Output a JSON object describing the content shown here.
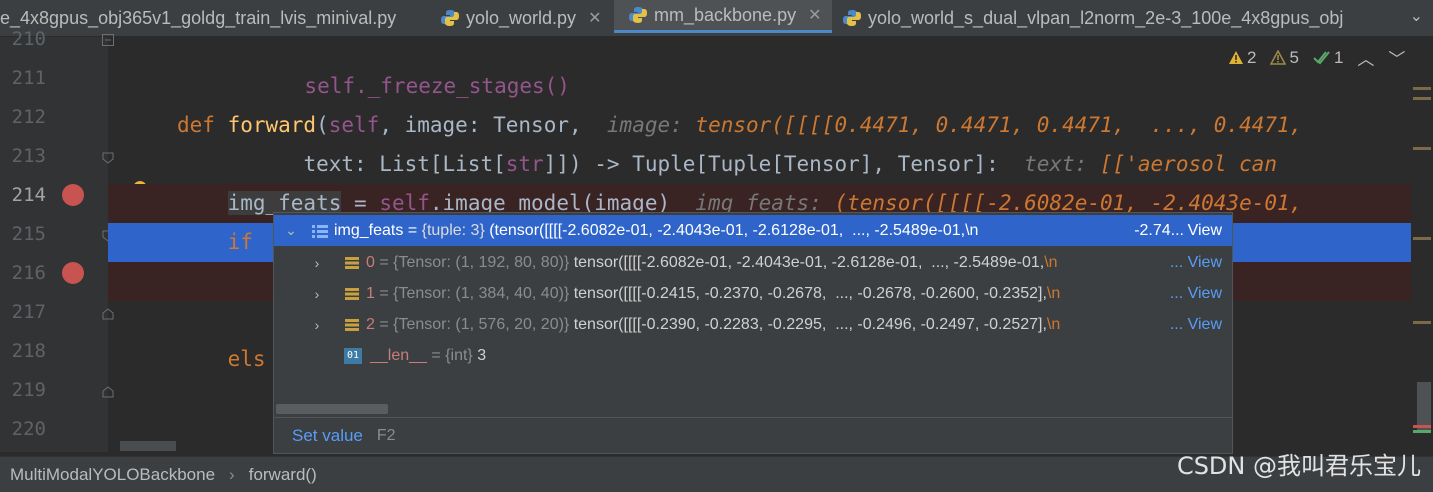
{
  "tabs": [
    {
      "label": "e_4x8gpus_obj365v1_goldg_train_lvis_minival.py",
      "active": false,
      "has_close": false
    },
    {
      "label": "yolo_world.py",
      "active": false,
      "has_close": true
    },
    {
      "label": "mm_backbone.py",
      "active": true,
      "has_close": true
    },
    {
      "label": "yolo_world_s_dual_vlpan_l2norm_2e-3_100e_4x8gpus_obj",
      "active": false,
      "has_close": false
    }
  ],
  "tabs_menu_icon": "chevron-down-icon",
  "inspections": {
    "warnings": "2",
    "weak_warnings": "5",
    "ok": "1"
  },
  "line_numbers": [
    "210",
    "211",
    "212",
    "213",
    "214",
    "215",
    "216",
    "217",
    "218",
    "219",
    "220"
  ],
  "current_line": "214",
  "code": {
    "l210": {
      "text": "    self._freeze_stages()"
    },
    "l212": {
      "kw": "def ",
      "fn": "forward",
      "p1": "(",
      "self": "self",
      "p2": ", image: Tensor,  ",
      "hint_name": "image: ",
      "hint_val": "tensor([[[[0.4471, 0.4471, 0.4471,  ..., 0.4471,"
    },
    "l213": {
      "indent": "          ",
      "p1": "text: List[List[",
      "str": "str",
      "p2": "]]) -> Tuple[Tuple[Tensor], Tensor]:  ",
      "hint_name": "text: ",
      "hint_val": "[['aerosol can"
    },
    "l214": {
      "indent": "    ",
      "var": "img_feats",
      "p1": " = ",
      "self": "self",
      "p2": ".image_model(image)  ",
      "hint_name": "img_feats: ",
      "hint_val": "(tensor([[[[-2.6082e-01, -2.4043e-01,"
    },
    "l215": {
      "indent": "    ",
      "kw": "if"
    },
    "l218": {
      "indent": "    ",
      "kw": "els"
    }
  },
  "debug_popup": {
    "root": {
      "name": "img_feats",
      "eq": " = ",
      "type": "{tuple: 3}",
      "value": " (tensor([[[[-2.6082e-01, -2.4043e-01, -2.6128e-01,  ..., -2.5489e-01,\\n",
      "tail": "-2.74...",
      "link": "View"
    },
    "children": [
      {
        "name": "0",
        "eq": " = ",
        "type": "{Tensor: (1, 192, 80, 80)}",
        "value": " tensor([[[[-2.6082e-01, -2.4043e-01, -2.6128e-01,  ..., -2.5489e-01,",
        "esc": "\\n",
        "link": "... View"
      },
      {
        "name": "1",
        "eq": " = ",
        "type": "{Tensor: (1, 384, 40, 40)}",
        "value": " tensor([[[[-0.2415, -0.2370, -0.2678,  ..., -0.2678, -0.2600, -0.2352],",
        "esc": "\\n",
        "link": "... View"
      },
      {
        "name": "2",
        "eq": " = ",
        "type": "{Tensor: (1, 576, 20, 20)}",
        "value": " tensor([[[[-0.2390, -0.2283, -0.2295,  ..., -0.2496, -0.2497, -0.2527],",
        "esc": "\\n",
        "link": "... View"
      }
    ],
    "len": {
      "name": "__len__",
      "eq": " = ",
      "type": "{int}",
      "value": " 3",
      "icon_label": "01"
    },
    "footer": {
      "action": "Set value",
      "shortcut": "F2"
    }
  },
  "breadcrumb": [
    "MultiModalYOLOBackbone",
    "forward()"
  ],
  "watermark": "CSDN @我叫君乐宝儿",
  "colors": {
    "breakpoint": "#c75450",
    "selection": "#2f65ca",
    "keyword": "#cc7832",
    "function": "#ffc66d",
    "self": "#94558d",
    "link": "#589df6"
  }
}
